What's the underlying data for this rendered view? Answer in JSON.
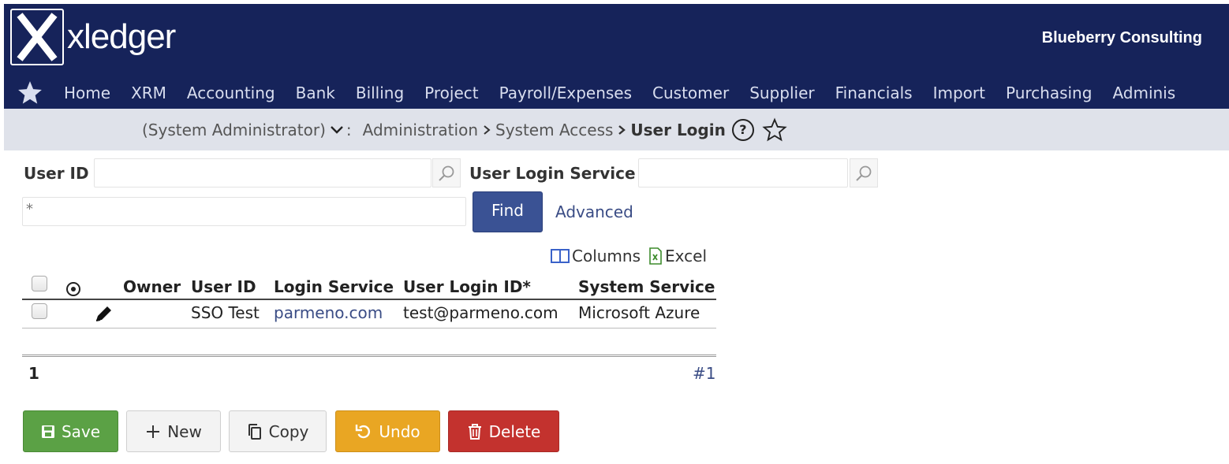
{
  "header": {
    "logo_text": "xledger",
    "company": "Blueberry Consulting"
  },
  "nav": {
    "items": [
      "Home",
      "XRM",
      "Accounting",
      "Bank",
      "Billing",
      "Project",
      "Payroll/Expenses",
      "Customer",
      "Supplier",
      "Financials",
      "Import",
      "Purchasing",
      "Adminis"
    ]
  },
  "breadcrumb": {
    "role": "(System Administrator)",
    "colon": ":",
    "level1": "Administration",
    "level2": "System Access",
    "current": "User Login",
    "help_glyph": "?"
  },
  "filters": {
    "user_id_label": "User ID",
    "user_id_value": "",
    "service_label": "User Login Service",
    "service_value": "",
    "text_filter_value": "*",
    "find_label": "Find",
    "advanced_label": "Advanced"
  },
  "tools": {
    "columns_label": "Columns",
    "excel_label": "Excel"
  },
  "table": {
    "headers": [
      "Owner",
      "User ID",
      "Login Service",
      "User Login ID*",
      "System Service"
    ],
    "rows": [
      {
        "owner": "",
        "user_id": "SSO Test",
        "login_service": "parmeno.com",
        "user_login_id": "test@parmeno.com",
        "system_service": "Microsoft Azure"
      }
    ]
  },
  "footer": {
    "count": "1",
    "page": "#1"
  },
  "actions": {
    "save": "Save",
    "new": "New",
    "copy": "Copy",
    "undo": "Undo",
    "delete": "Delete"
  },
  "colors": {
    "header_bg": "#16235a",
    "crumb_bg": "#dfe2ea",
    "find_bg": "#3a5294",
    "save_bg": "#5ba145",
    "undo_bg": "#e9a623",
    "delete_bg": "#c3322e"
  }
}
